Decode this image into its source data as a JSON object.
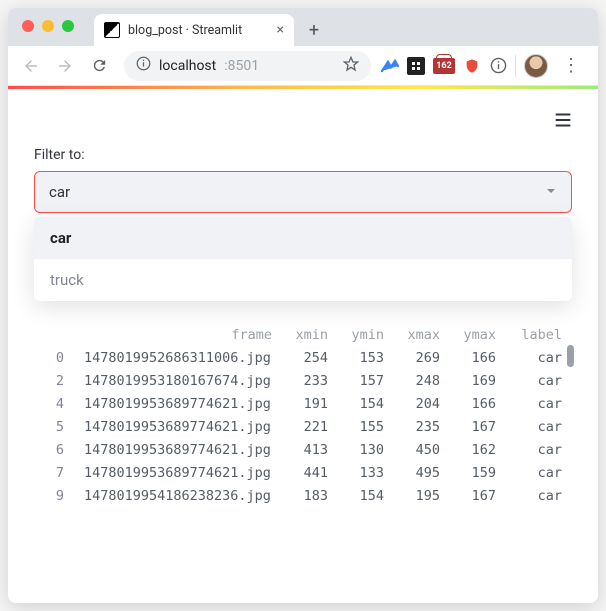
{
  "browser": {
    "tab_title": "blog_post · Streamlit",
    "url_host": "localhost",
    "url_port": ":8501",
    "badge_count": "162"
  },
  "app": {
    "filter_label": "Filter to:",
    "select_value": "car",
    "options": [
      "car",
      "truck"
    ]
  },
  "table": {
    "columns": [
      "frame",
      "xmin",
      "ymin",
      "xmax",
      "ymax",
      "label"
    ],
    "rows": [
      {
        "idx": "0",
        "frame": "1478019952686311006.jpg",
        "xmin": "254",
        "ymin": "153",
        "xmax": "269",
        "ymax": "166",
        "label": "car"
      },
      {
        "idx": "2",
        "frame": "1478019953180167674.jpg",
        "xmin": "233",
        "ymin": "157",
        "xmax": "248",
        "ymax": "169",
        "label": "car"
      },
      {
        "idx": "4",
        "frame": "1478019953689774621.jpg",
        "xmin": "191",
        "ymin": "154",
        "xmax": "204",
        "ymax": "166",
        "label": "car"
      },
      {
        "idx": "5",
        "frame": "1478019953689774621.jpg",
        "xmin": "221",
        "ymin": "155",
        "xmax": "235",
        "ymax": "167",
        "label": "car"
      },
      {
        "idx": "6",
        "frame": "1478019953689774621.jpg",
        "xmin": "413",
        "ymin": "130",
        "xmax": "450",
        "ymax": "162",
        "label": "car"
      },
      {
        "idx": "7",
        "frame": "1478019953689774621.jpg",
        "xmin": "441",
        "ymin": "133",
        "xmax": "495",
        "ymax": "159",
        "label": "car"
      },
      {
        "idx": "9",
        "frame": "1478019954186238236.jpg",
        "xmin": "183",
        "ymin": "154",
        "xmax": "195",
        "ymax": "167",
        "label": "car"
      }
    ]
  }
}
